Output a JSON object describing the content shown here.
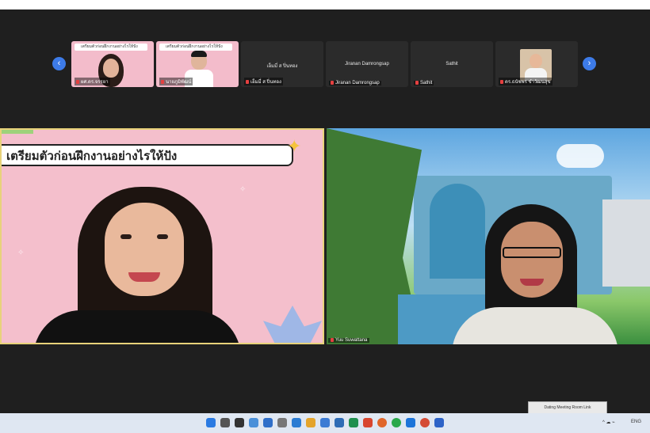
{
  "participants_strip": {
    "prev_label": "‹",
    "next_label": "›",
    "tiles": [
      {
        "banner": "เตรียมตัวก่อนฝึกงานอย่างไรให้ปัง",
        "name": "ผศ.ดร.จรรยา"
      },
      {
        "banner": "เตรียมตัวก่อนฝึกงานอย่างไรให้ปัง",
        "name": "นายภูมิพัฒน์"
      },
      {
        "display": "เอ็มมี่ ส ปิ่นทอง",
        "name": "เอ็มมี่ ส ปิ่นทอง"
      },
      {
        "display": "Jiranan Damrongsap",
        "name": "Jiranan Damrongsap"
      },
      {
        "display": "Sathit",
        "name": "Sathit"
      },
      {
        "name": "ดร.ธนัชพร ขำวัฒนสุข"
      }
    ]
  },
  "main_video": {
    "presenter_title": "เตรียมตัวก่อนฝึกงานอย่างไรให้ปัง",
    "speaker_name": "Yuu Suwattana"
  },
  "tooltip": "Dating Meeting Room Link",
  "taskbar": {
    "tray_time": "ENG",
    "tray_icons": "^ ☁ ⌁"
  },
  "colors": {
    "accent": "#3d7be8",
    "frame_bg": "#1f1f1f",
    "slide_pink": "#f4bfcc",
    "slide_border": "#e8d27a"
  }
}
